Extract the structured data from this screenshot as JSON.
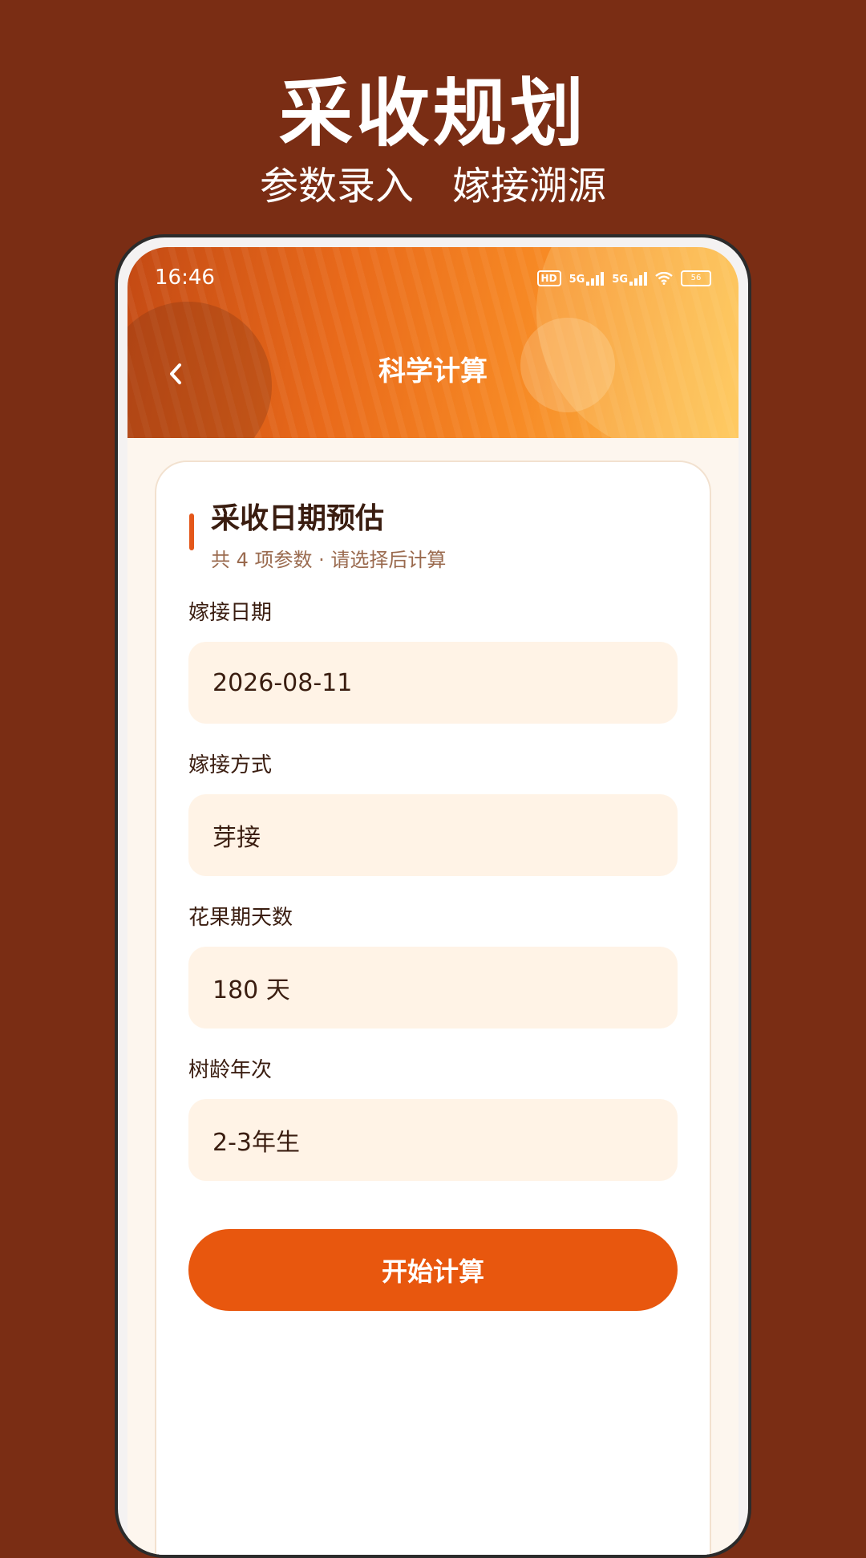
{
  "promo": {
    "title": "采收规划",
    "subtitle_left": "参数录入",
    "subtitle_right": "嫁接溯源"
  },
  "status_bar": {
    "time": "16:46",
    "hd": "HD",
    "net1": "5G",
    "net2": "5G",
    "battery": "56"
  },
  "nav": {
    "title": "科学计算"
  },
  "card": {
    "title": "采收日期预估",
    "subtitle": "共 4 项参数 · 请选择后计算",
    "fields": [
      {
        "label": "嫁接日期",
        "value": "2026-08-11"
      },
      {
        "label": "嫁接方式",
        "value": "芽接"
      },
      {
        "label": "花果期天数",
        "value": "180 天"
      },
      {
        "label": "树龄年次",
        "value": "2-3年生"
      }
    ],
    "button_label": "开始计算"
  },
  "colors": {
    "background": "#7a2d14",
    "accent": "#e8570e",
    "field_bg": "#fff3e6"
  }
}
